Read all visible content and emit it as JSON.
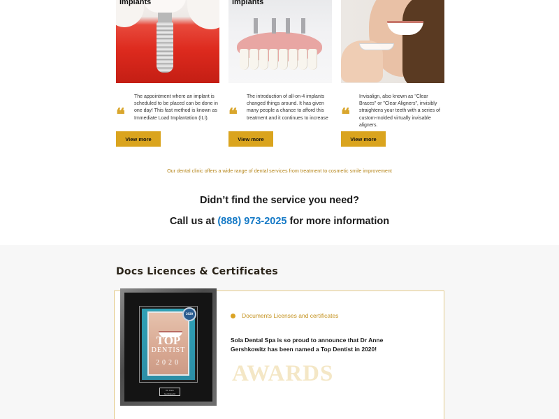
{
  "services": [
    {
      "title": "Implants",
      "text": "The appointment where an implant is scheduled to be placed can be done in one day! This fast method is known as Immediate Load Implantation (ILI).",
      "button": "View more",
      "image": "dental-implant-illustration"
    },
    {
      "title": "implants",
      "text": "The introduction of all-on-4 implants changed things around. It has given many people a chance to afford this treatment and it continues to increase",
      "button": "View more",
      "image": "all-on-4-denture-model"
    },
    {
      "title": "",
      "text": "Invisalign, also known as \"Clear Braces\" or \"Clear Aligners\", invisibly straightens your teeth with a series of custom-molded virtually invisable aligners.",
      "button": "View more",
      "image": "woman-holding-clear-aligner"
    }
  ],
  "quote_icon": "❝",
  "range_text": "Our dental clinic offers a wide range of dental services from treatment to cosmetic smile improvement",
  "cta": {
    "question": "Didn’t find the service you need?",
    "call_prefix": "Call us at ",
    "phone": "(888) 973-2025",
    "call_suffix": " for more information"
  },
  "certificates": {
    "heading": "Docs Licences & Certificates",
    "label": "Documents Licenses and certificates",
    "announcement": "Sola Dental Spa is so proud to announce that Dr Anne Gershkowitz has been named a Top Dentist in 2020!",
    "awards_watermark": "AWARDS",
    "plaque": {
      "seal": "2020",
      "top": "TOP",
      "dentist": "DENTIST",
      "year": "2020",
      "nameplate": "Dr. Anne Gershkowitz"
    }
  },
  "colors": {
    "accent_gold": "#daa41e",
    "phone_blue": "#1479c6",
    "section_bg": "#f7f7f7"
  }
}
